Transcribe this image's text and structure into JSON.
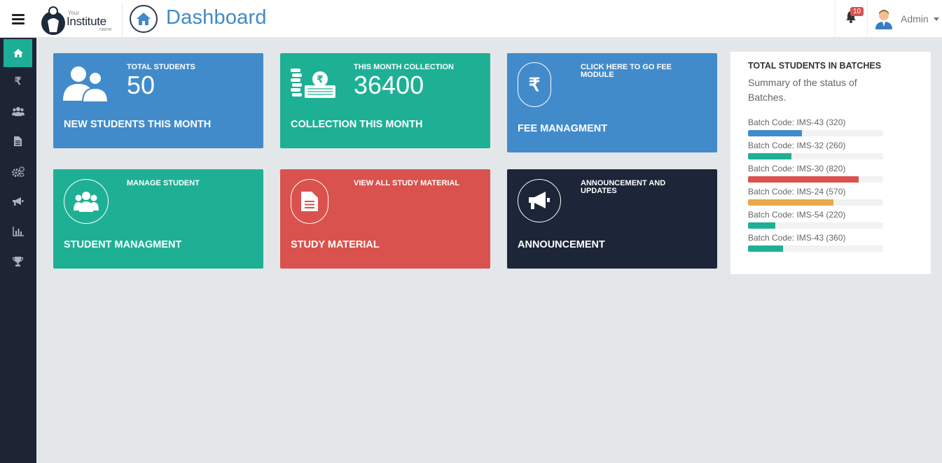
{
  "header": {
    "menu_icon": "hamburger-icon",
    "logo": {
      "small": "Your",
      "big": "Institute",
      "name": "name"
    },
    "page_title": "Dashboard",
    "home_icon": "home-icon",
    "notification_count": "10",
    "notification_icon": "bell-icon",
    "user_label": "Admin",
    "user_icon": "avatar-icon"
  },
  "sidebar": {
    "items": [
      {
        "name": "home",
        "icon": "home-icon",
        "active": true
      },
      {
        "name": "fees",
        "icon": "rupee-icon",
        "glyph": "₹"
      },
      {
        "name": "students",
        "icon": "users-icon"
      },
      {
        "name": "documents",
        "icon": "file-icon"
      },
      {
        "name": "settings",
        "icon": "gears-icon"
      },
      {
        "name": "announcements",
        "icon": "megaphone-icon"
      },
      {
        "name": "reports",
        "icon": "bar-chart-icon"
      },
      {
        "name": "achievements",
        "icon": "trophy-icon"
      }
    ]
  },
  "cards": {
    "new_students": {
      "small": "TOTAL STUDENTS",
      "value": "50",
      "title": "NEW STUDENTS THIS MONTH",
      "color": "#428bcb",
      "icon": "users-icon"
    },
    "collection": {
      "small": "THIS MONTH COLLECTION",
      "value": "36400",
      "title": "COLLECTION THIS MONTH",
      "color": "#1eb095",
      "icon": "money-icon"
    },
    "fee": {
      "small": "CLICK HERE TO GO FEE MODULE",
      "title": "FEE MANAGMENT",
      "color": "#428bcb",
      "icon": "rupee-icon",
      "glyph": "₹"
    },
    "student_mgmt": {
      "small": "MANAGE STUDENT",
      "title": "STUDENT MANAGMENT",
      "color": "#1eb095",
      "icon": "users-icon"
    },
    "study_material": {
      "small": "VIEW ALL STUDY MATERIAL",
      "title": "STUDY MATERIAL",
      "color": "#da524d",
      "icon": "file-icon"
    },
    "announcement": {
      "small": "ANNOUNCEMENT AND UPDATES",
      "title": "ANNOUNCEMENT",
      "color": "#1c2638",
      "icon": "megaphone-icon"
    }
  },
  "batches": {
    "title": "TOTAL STUDENTS IN BATCHES",
    "subtitle": "Summary of the status of Batches.",
    "items": [
      {
        "label": "Batch Code: IMS-43 (320)",
        "fill": 0.4,
        "color": "#428bcb"
      },
      {
        "label": "Batch Code: IMS-32 (260)",
        "fill": 0.32,
        "color": "#1eb095"
      },
      {
        "label": "Batch Code: IMS-30 (820)",
        "fill": 0.82,
        "color": "#da524d"
      },
      {
        "label": "Batch Code: IMS-24 (570)",
        "fill": 0.63,
        "color": "#e8a94a"
      },
      {
        "label": "Batch Code: IMS-54 (220)",
        "fill": 0.2,
        "color": "#1eb095"
      },
      {
        "label": "Batch Code: IMS-43 (360)",
        "fill": 0.26,
        "color": "#1eb095"
      }
    ]
  }
}
